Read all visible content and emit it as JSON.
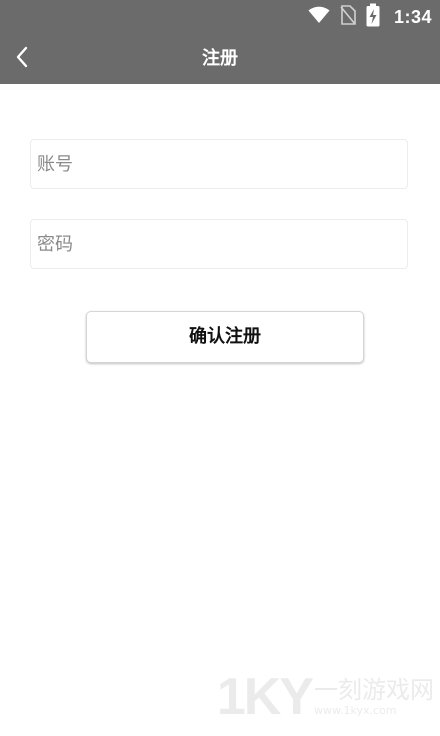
{
  "status_bar": {
    "time": "1:34",
    "icons": [
      "wifi-icon",
      "no-sim-icon",
      "battery-charging-icon"
    ]
  },
  "app_bar": {
    "title": "注册",
    "back_icon": "chevron-left-icon"
  },
  "form": {
    "account": {
      "placeholder": "账号",
      "value": ""
    },
    "password": {
      "placeholder": "密码",
      "value": ""
    },
    "submit_label": "确认注册"
  },
  "watermark": {
    "logo": "1KY",
    "name": "一刻游戏网",
    "url": "www.1kyx.com"
  },
  "colors": {
    "app_bar_bg": "#6b6b6b",
    "page_bg": "#ffffff",
    "field_border": "#ededed",
    "placeholder": "#8a8a8a"
  }
}
